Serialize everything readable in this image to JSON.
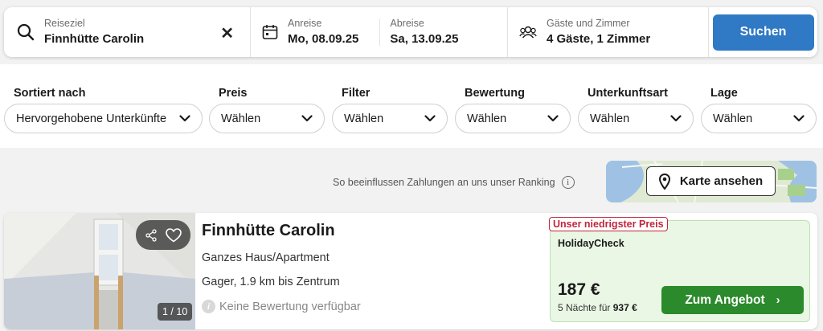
{
  "search": {
    "destination_label": "Reiseziel",
    "destination_value": "Finnhütte Carolin",
    "clear_symbol": "✕",
    "checkin_label": "Anreise",
    "checkin_value": "Mo, 08.09.25",
    "checkout_label": "Abreise",
    "checkout_value": "Sa, 13.09.25",
    "guests_label": "Gäste und Zimmer",
    "guests_value": "4 Gäste, 1 Zimmer",
    "search_button": "Suchen",
    "icons": [
      "search-icon",
      "calendar-icon",
      "guests-icon"
    ]
  },
  "filters": [
    {
      "label": "Sortiert nach",
      "value": "Hervorgehobene Unterkünfte"
    },
    {
      "label": "Preis",
      "value": "Wählen"
    },
    {
      "label": "Filter",
      "value": "Wählen"
    },
    {
      "label": "Bewertung",
      "value": "Wählen"
    },
    {
      "label": "Unterkunftsart",
      "value": "Wählen"
    },
    {
      "label": "Lage",
      "value": "Wählen"
    }
  ],
  "ranking": {
    "text": "So beeinflussen Zahlungen an uns unser Ranking",
    "info_symbol": "i"
  },
  "map": {
    "button_label": "Karte ansehen"
  },
  "listing": {
    "title": "Finnhütte Carolin",
    "type": "Ganzes Haus/Apartment",
    "location": "Gager, 1.9 km bis Zentrum",
    "rating_text": "Keine Bewertung verfügbar",
    "rating_symbol": "i",
    "image_counter": "1 / 10",
    "deal": {
      "badge": "Unser niedrigster Preis",
      "provider": "HolidayCheck",
      "price": "187 €",
      "total_prefix": "5 Nächte für",
      "total_value": "937 €",
      "button": "Zum Angebot",
      "button_chevron": "›"
    }
  },
  "colors": {
    "primary_blue": "#2f79c5",
    "cta_green": "#2b8a2b",
    "deal_bg": "#eaf7e5",
    "badge_red": "#c2263a"
  }
}
